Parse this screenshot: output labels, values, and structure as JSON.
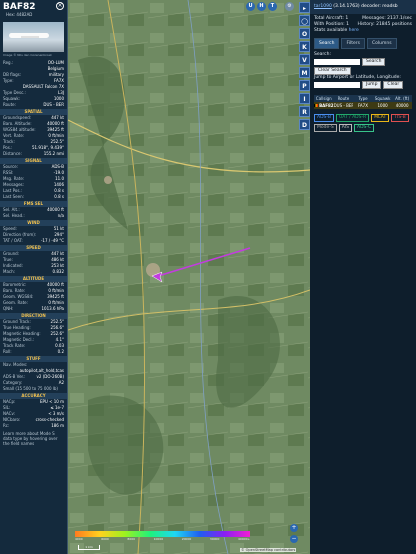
{
  "aircraft": {
    "callsign": "BAF82",
    "hex_label": "Hex: 4482AD",
    "photo_credit": "Image © Nils den Cozenenbroek"
  },
  "info": [
    {
      "k": "Reg.:",
      "v": "OO-LUM"
    },
    {
      "k": "",
      "v": "Belgium"
    },
    {
      "k": "DB flags:",
      "v": "military"
    },
    {
      "k": "Type:",
      "v": "FA7X"
    },
    {
      "k": "",
      "v": "DASSAULT Falcon 7X"
    },
    {
      "k": "Type Desc.:",
      "v": "L3J"
    },
    {
      "k": "Squawk:",
      "v": "1000"
    },
    {
      "k": "Route:",
      "v": "DUS - BER"
    }
  ],
  "sections": [
    {
      "title": "SPATIAL",
      "rows": [
        {
          "k": "Groundspeed:",
          "v": "447 kt"
        },
        {
          "k": "Baro. Altitude:",
          "v": "40000 ft"
        },
        {
          "k": "WGS84 altitude:",
          "v": "39425 ft"
        },
        {
          "k": "Vert. Rate:",
          "v": "0 ft/min"
        },
        {
          "k": "Track:",
          "v": "252.5°"
        },
        {
          "k": "Pos.:",
          "v": "51.918°, 9.439°"
        },
        {
          "k": "Distance:",
          "v": "155.2 nmi"
        }
      ]
    },
    {
      "title": "SIGNAL",
      "rows": [
        {
          "k": "Source:",
          "v": "ADS-B"
        },
        {
          "k": "RSSI:",
          "v": "-19.0"
        },
        {
          "k": "Msg. Rate:",
          "v": "11.0"
        },
        {
          "k": "Messages:",
          "v": "1406"
        },
        {
          "k": "Last Pos.:",
          "v": "0.8 s"
        },
        {
          "k": "Last Seen:",
          "v": "0.8 s"
        }
      ]
    },
    {
      "title": "FMS SEL",
      "rows": [
        {
          "k": "Sel. Alt.:",
          "v": "40000 ft"
        },
        {
          "k": "Sel. Head.:",
          "v": "n/a"
        }
      ]
    },
    {
      "title": "WIND",
      "rows": [
        {
          "k": "Speed:",
          "v": "51 kt"
        },
        {
          "k": "Direction (from):",
          "v": "294°"
        },
        {
          "k": "TAT / OAT:",
          "v": "-17 / -49 °C"
        }
      ]
    },
    {
      "title": "SPEED",
      "rows": [
        {
          "k": "Ground:",
          "v": "447 kt"
        },
        {
          "k": "True:",
          "v": "486 kt"
        },
        {
          "k": "Indicated:",
          "v": "253 kt"
        },
        {
          "k": "Mach:",
          "v": "0.832"
        }
      ]
    },
    {
      "title": "ALTITUDE",
      "rows": [
        {
          "k": "Barometric:",
          "v": "40000 ft"
        },
        {
          "k": "Baro. Rate:",
          "v": "0 ft/min"
        },
        {
          "k": "Geom. WGS84:",
          "v": "39425 ft"
        },
        {
          "k": "Geom. Rate:",
          "v": "0 ft/min"
        },
        {
          "k": "QNH:",
          "v": "1013.6 hPa"
        }
      ]
    },
    {
      "title": "DIRECTION",
      "rows": [
        {
          "k": "Ground Track:",
          "v": "252.5°"
        },
        {
          "k": "True Heading:",
          "v": "256.6°"
        },
        {
          "k": "Magnetic Heading:",
          "v": "252.6°"
        },
        {
          "k": "Magnetic Decl.:",
          "v": "4.1°"
        },
        {
          "k": "Track Rate:",
          "v": "0.03"
        },
        {
          "k": "Roll:",
          "v": "0.2"
        }
      ]
    },
    {
      "title": "STUFF",
      "rows": [
        {
          "k": "Nav. Modes:",
          "v": ""
        },
        {
          "k": "",
          "v": "autopilot,alt_hold,tcas"
        },
        {
          "k": "ADS-B Ver.:",
          "v": "v2 (DO-260B)"
        },
        {
          "k": "Category:",
          "v": "A2"
        },
        {
          "k": "Small (15 500 to 75 000 lb)",
          "v": ""
        }
      ]
    },
    {
      "title": "ACCURACY",
      "rows": [
        {
          "k": "NACp:",
          "v": "EPU < 10 m"
        },
        {
          "k": "SIL:",
          "v": "≤ 1e-7"
        },
        {
          "k": "NACv:",
          "v": "< 3 m/s"
        },
        {
          "k": "NICbaro:",
          "v": "cross-checked"
        },
        {
          "k": "Rc:",
          "v": "186 m"
        }
      ]
    }
  ],
  "sidebar_footer": "Learn more about Mode S data type by hovering over the field names",
  "map_controls": {
    "U": "U",
    "H": "H",
    "T": "T",
    "side": [
      "▸",
      "◯",
      "O",
      "K",
      "V",
      "M",
      "P",
      "I",
      "R",
      "D"
    ],
    "zoom_in": "+",
    "zoom_out": "−",
    "scale": "1 km",
    "legend": [
      "4000",
      "6000",
      "8000",
      "10000",
      "20000",
      "30000",
      "40000+"
    ],
    "attribution": "© OpenStreetMap contributors"
  },
  "panel": {
    "version_line": "tar1090 (3.14.1763) decoder: readsb",
    "version_link": "tar1090",
    "stats": {
      "total_label": "Total Aircraft: 1",
      "messages_label": "Messages: 2137.1/sec",
      "position_label": "With Position: 1",
      "history_label": "History: 21845 positions",
      "stats_label": "Stats available",
      "stats_link": "here"
    },
    "tabs": [
      "Search",
      "Filters",
      "Columns"
    ],
    "search": {
      "label": "Search:",
      "search_btn": "Search",
      "clear_btn": "Clear Search",
      "jump_label": "Jump to Airport or Latitude, Longitude:",
      "jump_btn": "Jump",
      "clear2_btn": "Clear"
    },
    "table": {
      "headers": [
        "Callsign",
        "Route",
        "Type",
        "Squawk",
        "Alt. (ft)"
      ],
      "row": [
        "BAF82",
        "DUS - BER",
        "FA7X",
        "1000",
        "40000"
      ]
    },
    "chips": [
      {
        "label": "ADS-B",
        "color": "#4a8ff0"
      },
      {
        "label": "UAT / ADS-R",
        "color": "#22a86b"
      },
      {
        "label": "MLAT",
        "color": "#e8b518"
      },
      {
        "label": "TIS-B",
        "color": "#e05050"
      },
      {
        "label": "Mode-S",
        "color": "#aaaaaa"
      },
      {
        "label": "AIS",
        "color": "#bbbbbb"
      },
      {
        "label": "ADS-C",
        "color": "#38c48a"
      }
    ]
  }
}
